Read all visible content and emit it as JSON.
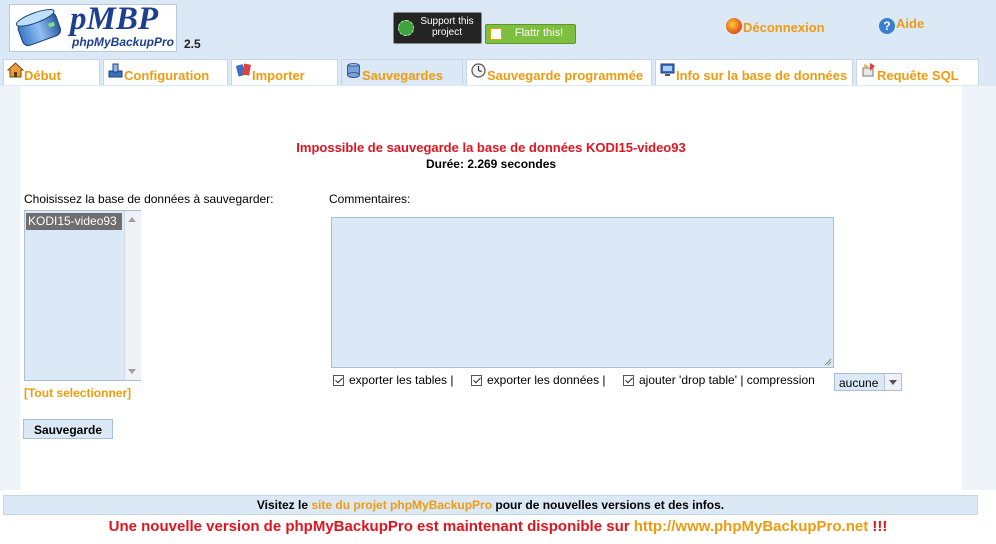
{
  "header": {
    "logo_text": "pMBP",
    "logo_subtext": "phpMyBackupPro",
    "version": "2.5",
    "support_label": "Support this project",
    "flattr_label": "Flattr this!",
    "logout_label": "Déconnexion",
    "help_label": "Aide"
  },
  "tabs": [
    {
      "label": "Début",
      "icon": "home-icon"
    },
    {
      "label": "Configuration",
      "icon": "configuration-icon"
    },
    {
      "label": "Importer",
      "icon": "import-icon"
    },
    {
      "label": "Sauvegardes",
      "icon": "backup-icon"
    },
    {
      "label": "Sauvegarde programmée",
      "icon": "clock-icon"
    },
    {
      "label": "Info sur la base de données",
      "icon": "database-info-icon"
    },
    {
      "label": "Requête SQL",
      "icon": "sql-query-icon"
    }
  ],
  "active_tab": "Sauvegardes",
  "main": {
    "error_message": "Impossible de sauvegarde la base de données KODI15-video93",
    "duration_label": "Durée:",
    "duration_value": "2.269 secondes",
    "db_select_label": "Choisissez la base de données à sauvegarder:",
    "db_options": [
      "KODI15-video93"
    ],
    "select_all_label": "[Tout selectionner]",
    "comments_label": "Commentaires:",
    "comments_value": "",
    "options": {
      "export_tables": "exporter les tables |",
      "export_data": "exporter les données |",
      "add_drop": "ajouter 'drop table' | compression"
    },
    "compression_value": "aucune",
    "save_label": "Sauvegarde"
  },
  "footer": {
    "visit_prefix": "Visitez le ",
    "visit_link": "site du projet phpMyBackupPro",
    "visit_suffix": " pour de nouvelles versions et des infos.",
    "new_version_text": "Une nouvelle version de phpMyBackupPro est maintenant disponible sur ",
    "new_version_link": "http://www.phpMyBackupPro.net",
    "new_version_suffix": " !!!"
  },
  "colors": {
    "accent": "#ef9b0f",
    "error": "#e0141e",
    "panel": "#dbe8f5"
  }
}
